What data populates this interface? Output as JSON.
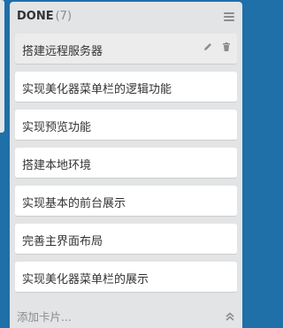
{
  "list": {
    "title": "DONE",
    "count": "(7)",
    "menu_icon": "hamburger-menu-icon",
    "cards": [
      {
        "text": "搭建远程服务器",
        "hovered": true
      },
      {
        "text": "实现美化器菜单栏的逻辑功能"
      },
      {
        "text": "实现预览功能"
      },
      {
        "text": "搭建本地环境"
      },
      {
        "text": "实现基本的前台展示"
      },
      {
        "text": "完善主界面布局"
      },
      {
        "text": "实现美化器菜单栏的展示"
      }
    ],
    "card_tools": [
      "pencil-edit-icon",
      "trash-icon"
    ],
    "add_card_label": "添加卡片...",
    "collapse_icon": "double-chevron-up-icon"
  },
  "colors": {
    "board_background": "#1f6fa8",
    "list_background": "#e2e4e6",
    "card_background": "#ffffff",
    "hover_card_background": "#ececec",
    "muted_text": "#8c8c8c"
  }
}
